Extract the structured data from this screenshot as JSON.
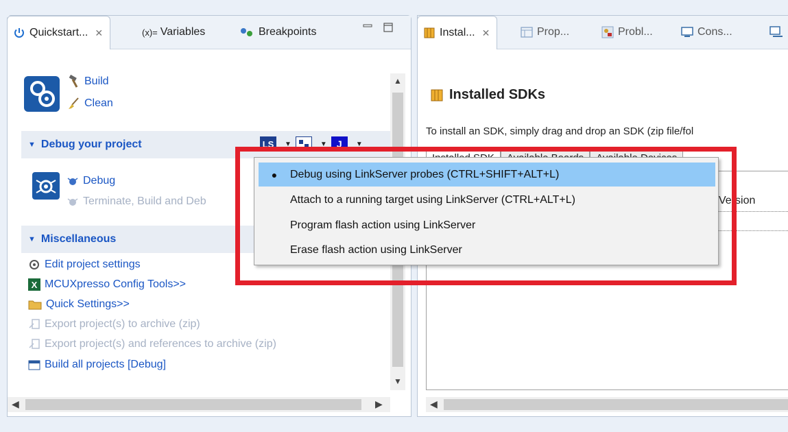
{
  "left_tabs": {
    "quickstart": "Quickstart...",
    "variables_prefix": "(x)=",
    "variables": "Variables",
    "breakpoints": "Breakpoints"
  },
  "build_group": {
    "build": "Build",
    "clean": "Clean"
  },
  "debug_section": {
    "title": "Debug your project",
    "debug": "Debug",
    "terminate": "Terminate, Build and Deb"
  },
  "misc_section": {
    "title": "Miscellaneous",
    "items": [
      "Edit project settings",
      "MCUXpresso Config Tools>>",
      "Quick Settings>>",
      "Export project(s) to archive (zip)",
      "Export project(s) and references to archive (zip)",
      "Build all projects [Debug]"
    ]
  },
  "toolbar_icons": {
    "ls": "LS",
    "j": "J"
  },
  "right_tabs": {
    "installed": "Instal...",
    "properties": "Prop...",
    "problems": "Probl...",
    "console": "Cons..."
  },
  "sdk": {
    "title": "Installed SDKs",
    "instruction": "To install an SDK, simply drag and drop an SDK (zip file/fol",
    "subtabs": [
      "Installed SDK",
      "Available Boards",
      "Available Devices"
    ],
    "version_header": "Version"
  },
  "context_menu": {
    "items": [
      "Debug using LinkServer probes (CTRL+SHIFT+ALT+L)",
      "Attach to a running target using LinkServer (CTRL+ALT+L)",
      "Program flash action using LinkServer",
      "Erase flash action using LinkServer"
    ],
    "selected_index": 0
  },
  "colors": {
    "highlight": "#e3202b",
    "link": "#1a56c4",
    "menu_selection": "#91c9f7"
  }
}
